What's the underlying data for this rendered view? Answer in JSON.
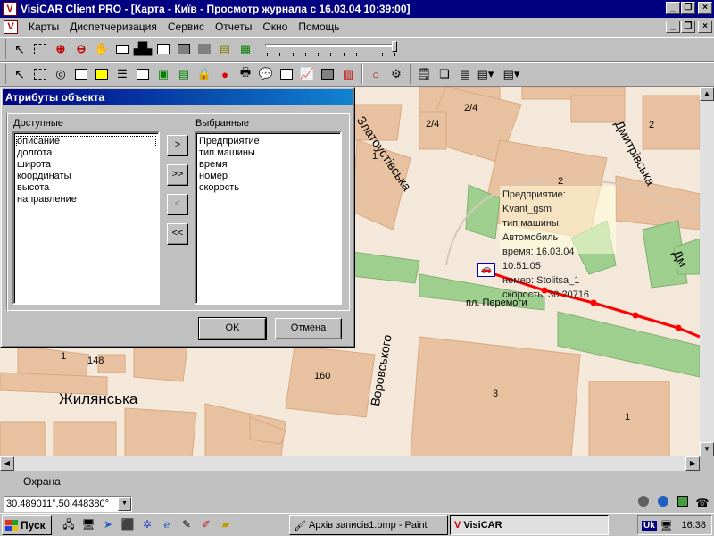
{
  "window": {
    "title": "VisiCAR Client PRO - [Карта - Київ - Просмотр журнала с 16.03.04 10:39:00]",
    "icon": "visicar-icon",
    "min_glyph": "_",
    "max_glyph": "❐",
    "close_glyph": "×"
  },
  "menu": {
    "items": [
      "Карты",
      "Диспетчеризация",
      "Сервис",
      "Отчеты",
      "Окно",
      "Помощь"
    ]
  },
  "map": {
    "labels": {
      "zlatoust": "Златоустівська",
      "dmytrivska": "Дмитрівська",
      "dm_cut": "Дм",
      "vorovskogo": "Воровського",
      "zhylyanska": "Жилянська",
      "pl_peremohy": "пл. Перемоги",
      "h24a": "2/4",
      "h24b": "2/4",
      "h2a": "2",
      "h2b": "2",
      "h1a": "1",
      "h1b": "1",
      "h1c": "1",
      "h148": "148",
      "h160": "160",
      "h3": "3"
    },
    "tooltip": {
      "line1": "Предприятие: Kvant_gsm",
      "line2": "тип машины: Автомобиль",
      "line3": "время: 16.03.04 10:51:05",
      "line4": "номер: Stolitsa_1",
      "line5": "скорость: 30.20716"
    },
    "track_color": "#ff0000"
  },
  "dialog": {
    "title": "Атрибуты объекта",
    "available_label": "Доступные",
    "selected_label": "Выбранные",
    "available": [
      "описание",
      "долгота",
      "широта",
      "координаты",
      "высота",
      "направление"
    ],
    "selected": [
      "Предприятие",
      "тип машины",
      "время",
      "номер",
      "скорость"
    ],
    "btn_add": ">",
    "btn_add_all": ">>",
    "btn_remove": "<",
    "btn_remove_all": "<<",
    "ok": "OK",
    "cancel": "Отмена"
  },
  "status": {
    "tab": "Охрана",
    "coords": "30.489011°,50.448380°"
  },
  "taskbar": {
    "start": "Пуск",
    "task1": "Архів записів1.bmp - Paint",
    "task2": "VisiCAR",
    "lang": "Uk",
    "clock": "16:38"
  }
}
